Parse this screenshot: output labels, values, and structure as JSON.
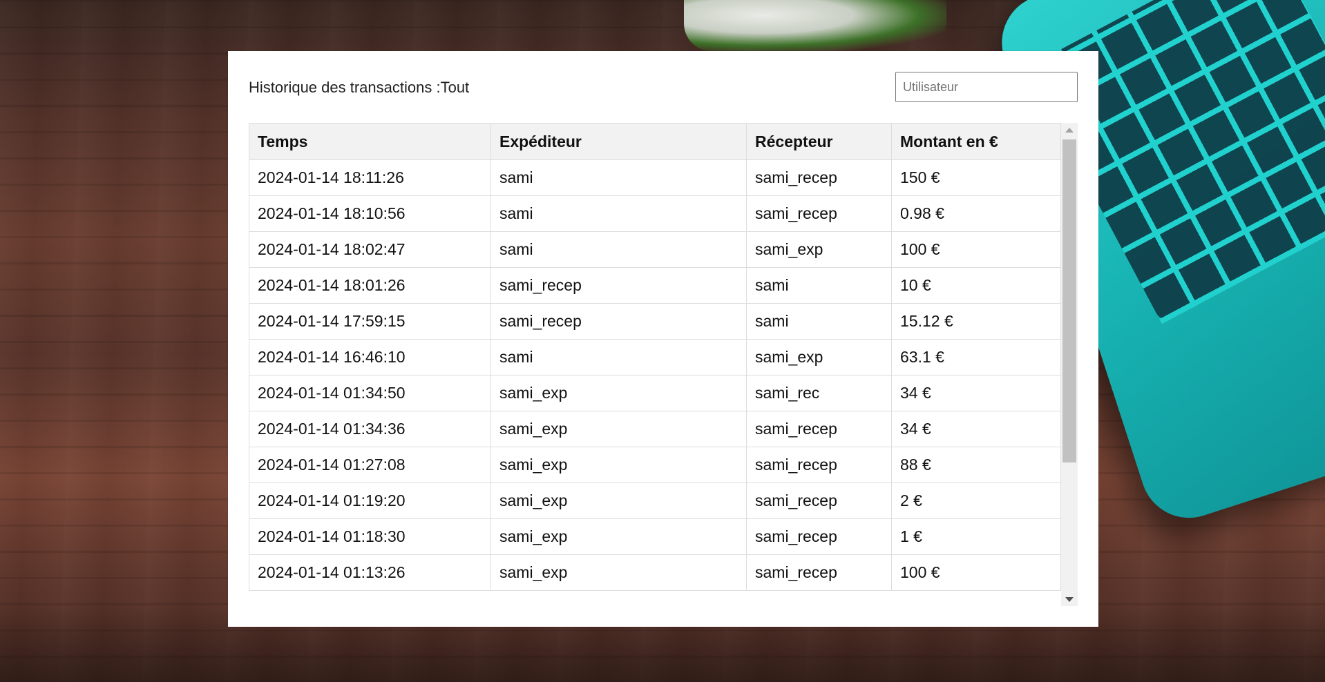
{
  "panel": {
    "title": "Historique des transactions :Tout",
    "filter": {
      "placeholder": "Utilisateur",
      "value": ""
    }
  },
  "table": {
    "headers": [
      "Temps",
      "Expéditeur",
      "Récepteur",
      "Montant en €"
    ],
    "rows": [
      [
        "2024-01-14 18:11:26",
        "sami",
        "sami_recep",
        "150 €"
      ],
      [
        "2024-01-14 18:10:56",
        "sami",
        "sami_recep",
        "0.98 €"
      ],
      [
        "2024-01-14 18:02:47",
        "sami",
        "sami_exp",
        "100 €"
      ],
      [
        "2024-01-14 18:01:26",
        "sami_recep",
        "sami",
        "10 €"
      ],
      [
        "2024-01-14 17:59:15",
        "sami_recep",
        "sami",
        "15.12 €"
      ],
      [
        "2024-01-14 16:46:10",
        "sami",
        "sami_exp",
        "63.1 €"
      ],
      [
        "2024-01-14 01:34:50",
        "sami_exp",
        "sami_rec",
        "34 €"
      ],
      [
        "2024-01-14 01:34:36",
        "sami_exp",
        "sami_recep",
        "34 €"
      ],
      [
        "2024-01-14 01:27:08",
        "sami_exp",
        "sami_recep",
        "88 €"
      ],
      [
        "2024-01-14 01:19:20",
        "sami_exp",
        "sami_recep",
        "2 €"
      ],
      [
        "2024-01-14 01:18:30",
        "sami_exp",
        "sami_recep",
        "1 €"
      ],
      [
        "2024-01-14 01:13:26",
        "sami_exp",
        "sami_recep",
        "100 €"
      ]
    ]
  },
  "icons": {
    "scroll_up": "arrow-up-icon",
    "scroll_down": "arrow-down-icon"
  }
}
